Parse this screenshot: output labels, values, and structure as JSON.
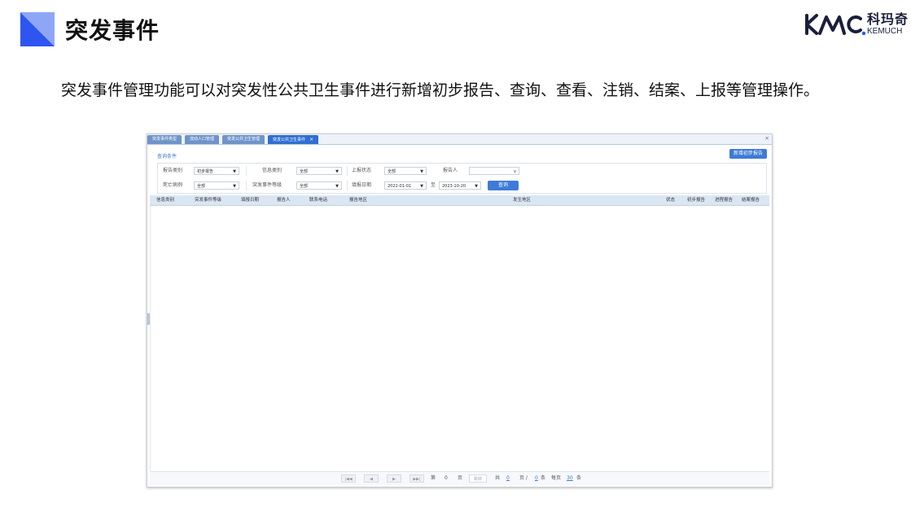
{
  "header": {
    "title": "突发事件",
    "logo_cn": "科玛奇",
    "logo_en": "KEMUCH"
  },
  "paragraph": "突发事件管理功能可以对突发性公共卫生事件进行新增初步报告、查询、查看、注销、结案、上报等管理操作。",
  "colors": {
    "accent": "#3e7ad6",
    "title_mark_blue": "#2d55f0",
    "title_mark_light": "#8fa6f7",
    "logo": "#1a1f3a"
  },
  "app": {
    "tabs": [
      {
        "label": "突发事件类型"
      },
      {
        "label": "流动人口管理"
      },
      {
        "label": "突发公共卫生管理"
      },
      {
        "label": "突发公共卫生事件",
        "active": true
      }
    ],
    "close_glyph": "×",
    "section_title": "查询条件",
    "add_button": "新增初步报告",
    "filters": {
      "row1": [
        {
          "label": "报告类别",
          "value": "初步报告"
        },
        {
          "label": "信息类别",
          "value": "全部"
        },
        {
          "label": "上报状态",
          "value": "全部"
        },
        {
          "label": "报告人",
          "value": ""
        }
      ],
      "row2": [
        {
          "label": "死亡病例",
          "value": "全部"
        },
        {
          "label": "突发事件等级",
          "value": "全部"
        },
        {
          "label": "填报日期",
          "value": "2022-01-01"
        },
        {
          "label": "至",
          "value": "2023-10-20"
        }
      ],
      "query_button": "查询"
    },
    "columns": [
      "信息类别",
      "突发事件等级",
      "填报日期",
      "报告人",
      "联系电话",
      "报告地区",
      "发生地区",
      "状态",
      "初步报告",
      "进程报告",
      "结案报告"
    ],
    "pager": {
      "first": "|◀◀",
      "prev": "◀",
      "next": "▶",
      "last": "▶▶|",
      "page_label_before": "第",
      "page_value": "0",
      "page_label_after": "页",
      "go_label": "跳转",
      "total_prefix": "共",
      "total_pages": "0",
      "total_mid": "页 /",
      "total_records": "0",
      "total_suffix": "条",
      "per_page_prefix": "每页",
      "per_page": "30",
      "per_page_suffix": "条"
    }
  }
}
